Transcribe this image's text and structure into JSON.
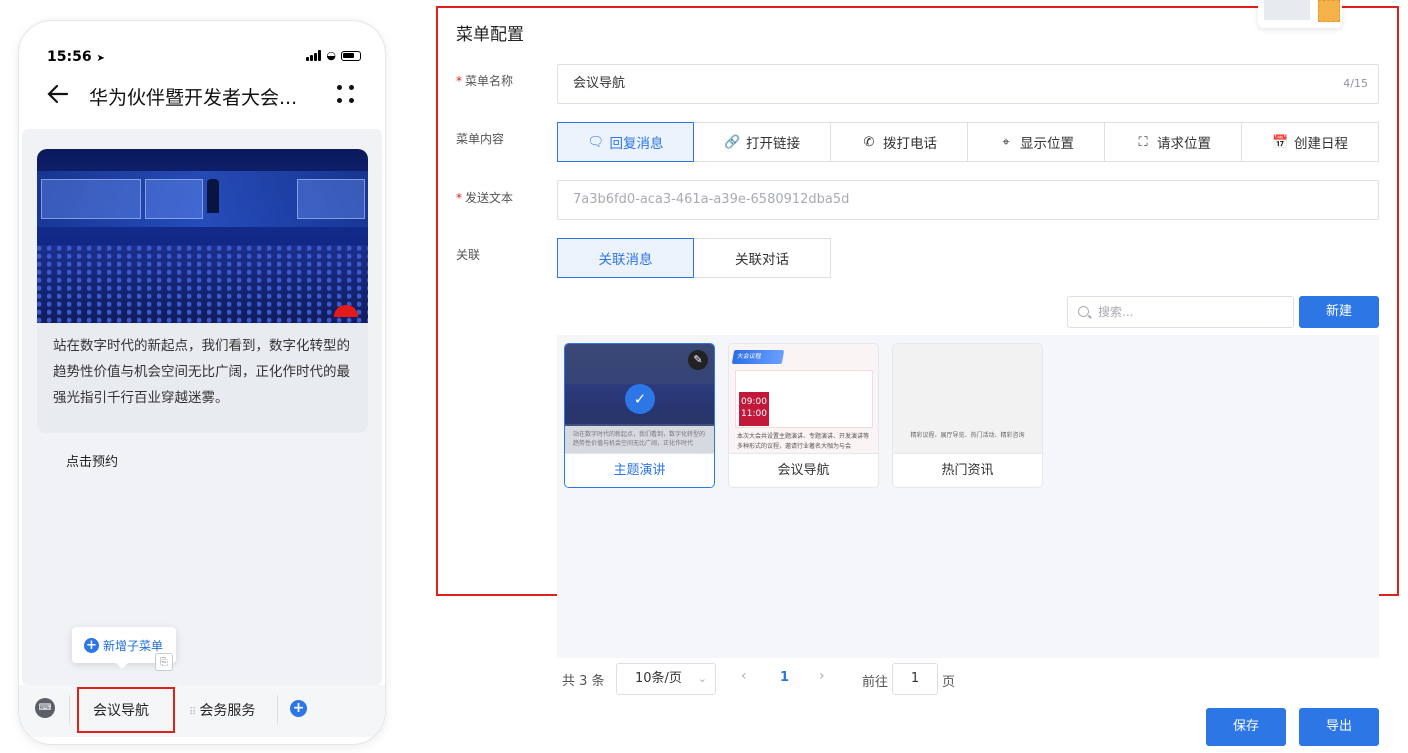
{
  "phone": {
    "time": "15:56",
    "chat_title": "华为伙伴暨开发者大会...",
    "message_text": "站在数字时代的新起点，我们看到，数字化转型的趋势性价值与机会空间无比广阔，正化作时代的最强光指引千行百业穿越迷雾。",
    "booking_label": "点击预约",
    "tooltip_label": "新增子菜单",
    "menu_items": [
      "会议导航",
      "会务服务"
    ]
  },
  "panel": {
    "title": "菜单配置",
    "name_label": "菜单名称",
    "name_value": "会议导航",
    "name_counter": "4/15",
    "content_label": "菜单内容",
    "content_options": [
      {
        "label": "回复消息",
        "icon": "message-icon"
      },
      {
        "label": "打开链接",
        "icon": "link-icon"
      },
      {
        "label": "拨打电话",
        "icon": "phone-icon"
      },
      {
        "label": "显示位置",
        "icon": "location-icon"
      },
      {
        "label": "请求位置",
        "icon": "scan-location-icon"
      },
      {
        "label": "创建日程",
        "icon": "calendar-icon"
      }
    ],
    "content_selected": "回复消息",
    "send_text_label": "发送文本",
    "send_text_placeholder": "7a3b6fd0-aca3-461a-a39e-6580912dba5d",
    "link_label": "关联",
    "link_options": [
      "关联消息",
      "关联对话"
    ],
    "link_selected": "关联消息",
    "search_placeholder": "搜索...",
    "new_button": "新建",
    "cards": [
      {
        "label": "主题演讲",
        "selected": true,
        "caption": "站在数字时代的新起点，我们看到，数字化转型的趋势性价值与机会空间无比广阔，正化作时代"
      },
      {
        "label": "会议导航",
        "selected": false,
        "banner": "大会议程",
        "date_top": "09:00",
        "date_bottom": "11:00",
        "caption": "本次大会共设置主题演讲、专题演讲、开发演讲等多种形式的议程，邀请行业著名大咖为与会"
      },
      {
        "label": "热门资讯",
        "selected": false,
        "caption": "精彩议程、展厅导览、热门活动、精彩咨询"
      }
    ],
    "pagination": {
      "total": "共 3 条",
      "page_size": "10条/页",
      "current_page": "1",
      "goto_label": "前往",
      "goto_value": "1",
      "page_suffix": "页"
    },
    "save_button": "保存",
    "export_button": "导出"
  },
  "colors": {
    "accent": "#2d76e6",
    "highlight_border": "#e0201a",
    "active_bg": "#ecf3fd"
  }
}
